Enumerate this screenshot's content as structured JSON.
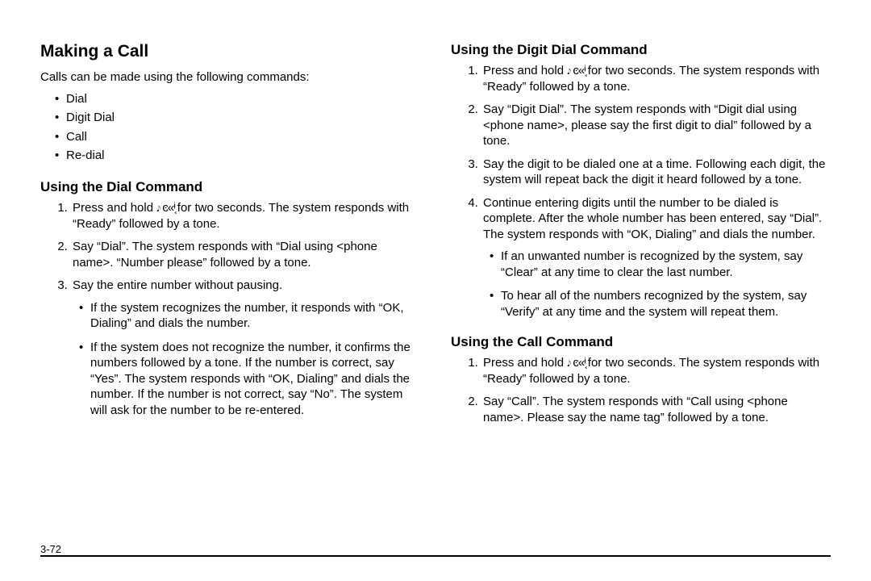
{
  "glyph": " 𝆕 ͼ«ᶤ͔ ",
  "left": {
    "h1": "Making a Call",
    "intro": "Calls can be made using the following commands:",
    "bullets": [
      "Dial",
      "Digit Dial",
      "Call",
      "Re-dial"
    ],
    "h2": "Using the Dial Command",
    "steps": {
      "s1_a": "Press and hold",
      "s1_b": "for two seconds. The system responds with “Ready” followed by a tone.",
      "s2": "Say “Dial”. The system responds with “Dial using <phone name>. “Number please” followed by a tone.",
      "s3": "Say the entire number without pausing.",
      "s3_b1": "If the system recognizes the number, it responds with “OK, Dialing” and dials the number.",
      "s3_b2": "If the system does not recognize the number, it confirms the numbers followed by a tone. If the number is correct, say “Yes”. The system responds with “OK, Dialing” and dials the number. If the number is not correct, say “No”. The system will ask for the number to be re-entered."
    }
  },
  "right": {
    "h2a": "Using the Digit Dial Command",
    "digit": {
      "s1_a": "Press and hold",
      "s1_b": "for two seconds. The system responds with “Ready” followed by a tone.",
      "s2": "Say “Digit Dial”. The system responds with “Digit dial using <phone name>, please say the first digit to dial” followed by a tone.",
      "s3": "Say the digit to be dialed one at a time. Following each digit, the system will repeat back the digit it heard followed by a tone.",
      "s4": "Continue entering digits until the number to be dialed is complete. After the whole number has been entered, say “Dial”. The system responds with “OK, Dialing” and dials the number.",
      "s4_b1": "If an unwanted number is recognized by the system, say “Clear” at any time to clear the last number.",
      "s4_b2": "To hear all of the numbers recognized by the system, say “Verify” at any time and the system will repeat them."
    },
    "h2b": "Using the Call Command",
    "call": {
      "s1_a": "Press and hold",
      "s1_b": "for two seconds. The system responds with “Ready” followed by a tone.",
      "s2": "Say “Call”. The system responds with “Call using <phone name>. Please say the name tag” followed by a tone."
    }
  },
  "page_number": "3-72"
}
